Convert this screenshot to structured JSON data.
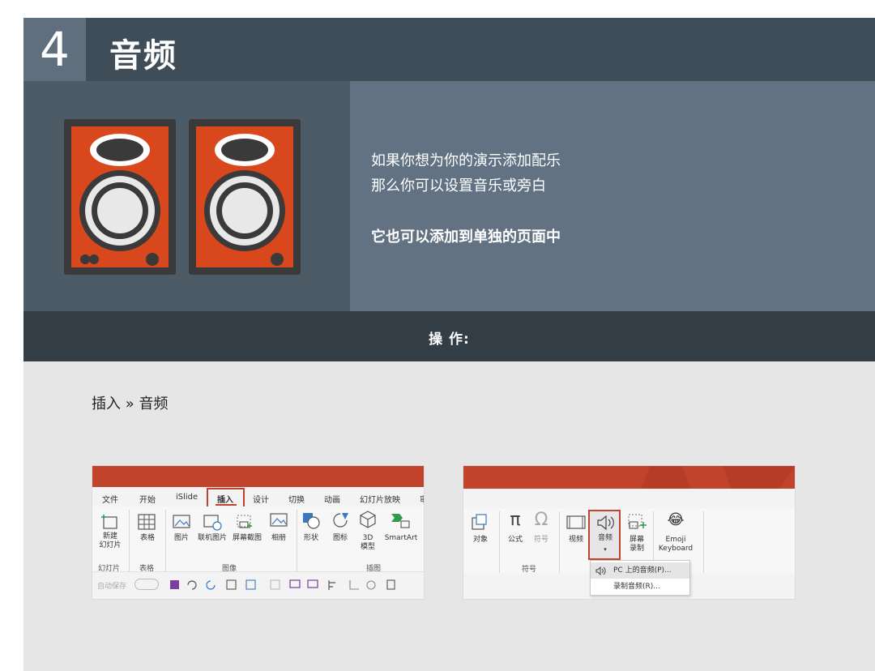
{
  "header": {
    "number": "4",
    "title": "音频"
  },
  "hero": {
    "line1": "如果你想为你的演示添加配乐",
    "line2": "那么你可以设置音乐或旁白",
    "line3": "它也可以添加到单独的页面中"
  },
  "ops": {
    "label": "操 作:"
  },
  "path": "插入 » 音频",
  "colors": {
    "accent": "#c1432b",
    "speaker": "#d9471c",
    "header_bg": "#3f4d58"
  },
  "shot1": {
    "tabs": [
      "文件",
      "开始",
      "iSlide",
      "插入",
      "设计",
      "切换",
      "动画",
      "幻灯片放映",
      "审"
    ],
    "buttons": {
      "new_slide": "新建",
      "new_slide2": "幻灯片",
      "table": "表格",
      "picture": "图片",
      "online_picture": "联机图片",
      "screenshot": "屏幕截图",
      "album": "相册",
      "shapes": "形状",
      "icons": "图标",
      "model3d": "3D",
      "model3d2": "模型",
      "smartart": "SmartArt"
    },
    "groups": [
      "幻灯片",
      "表格",
      "图像",
      "插图"
    ],
    "qat_label": "自动保存"
  },
  "shot2": {
    "buttons": {
      "object": "对象",
      "equation": "公式",
      "symbol": "符号",
      "video": "视频",
      "audio": "音频",
      "screen_record": "屏幕",
      "screen_record2": "录制",
      "emoji": "Emoji",
      "emoji2": "Keyboard"
    },
    "groups": [
      "符号"
    ],
    "menu": [
      "PC 上的音频(P)...",
      "录制音频(R)..."
    ]
  }
}
